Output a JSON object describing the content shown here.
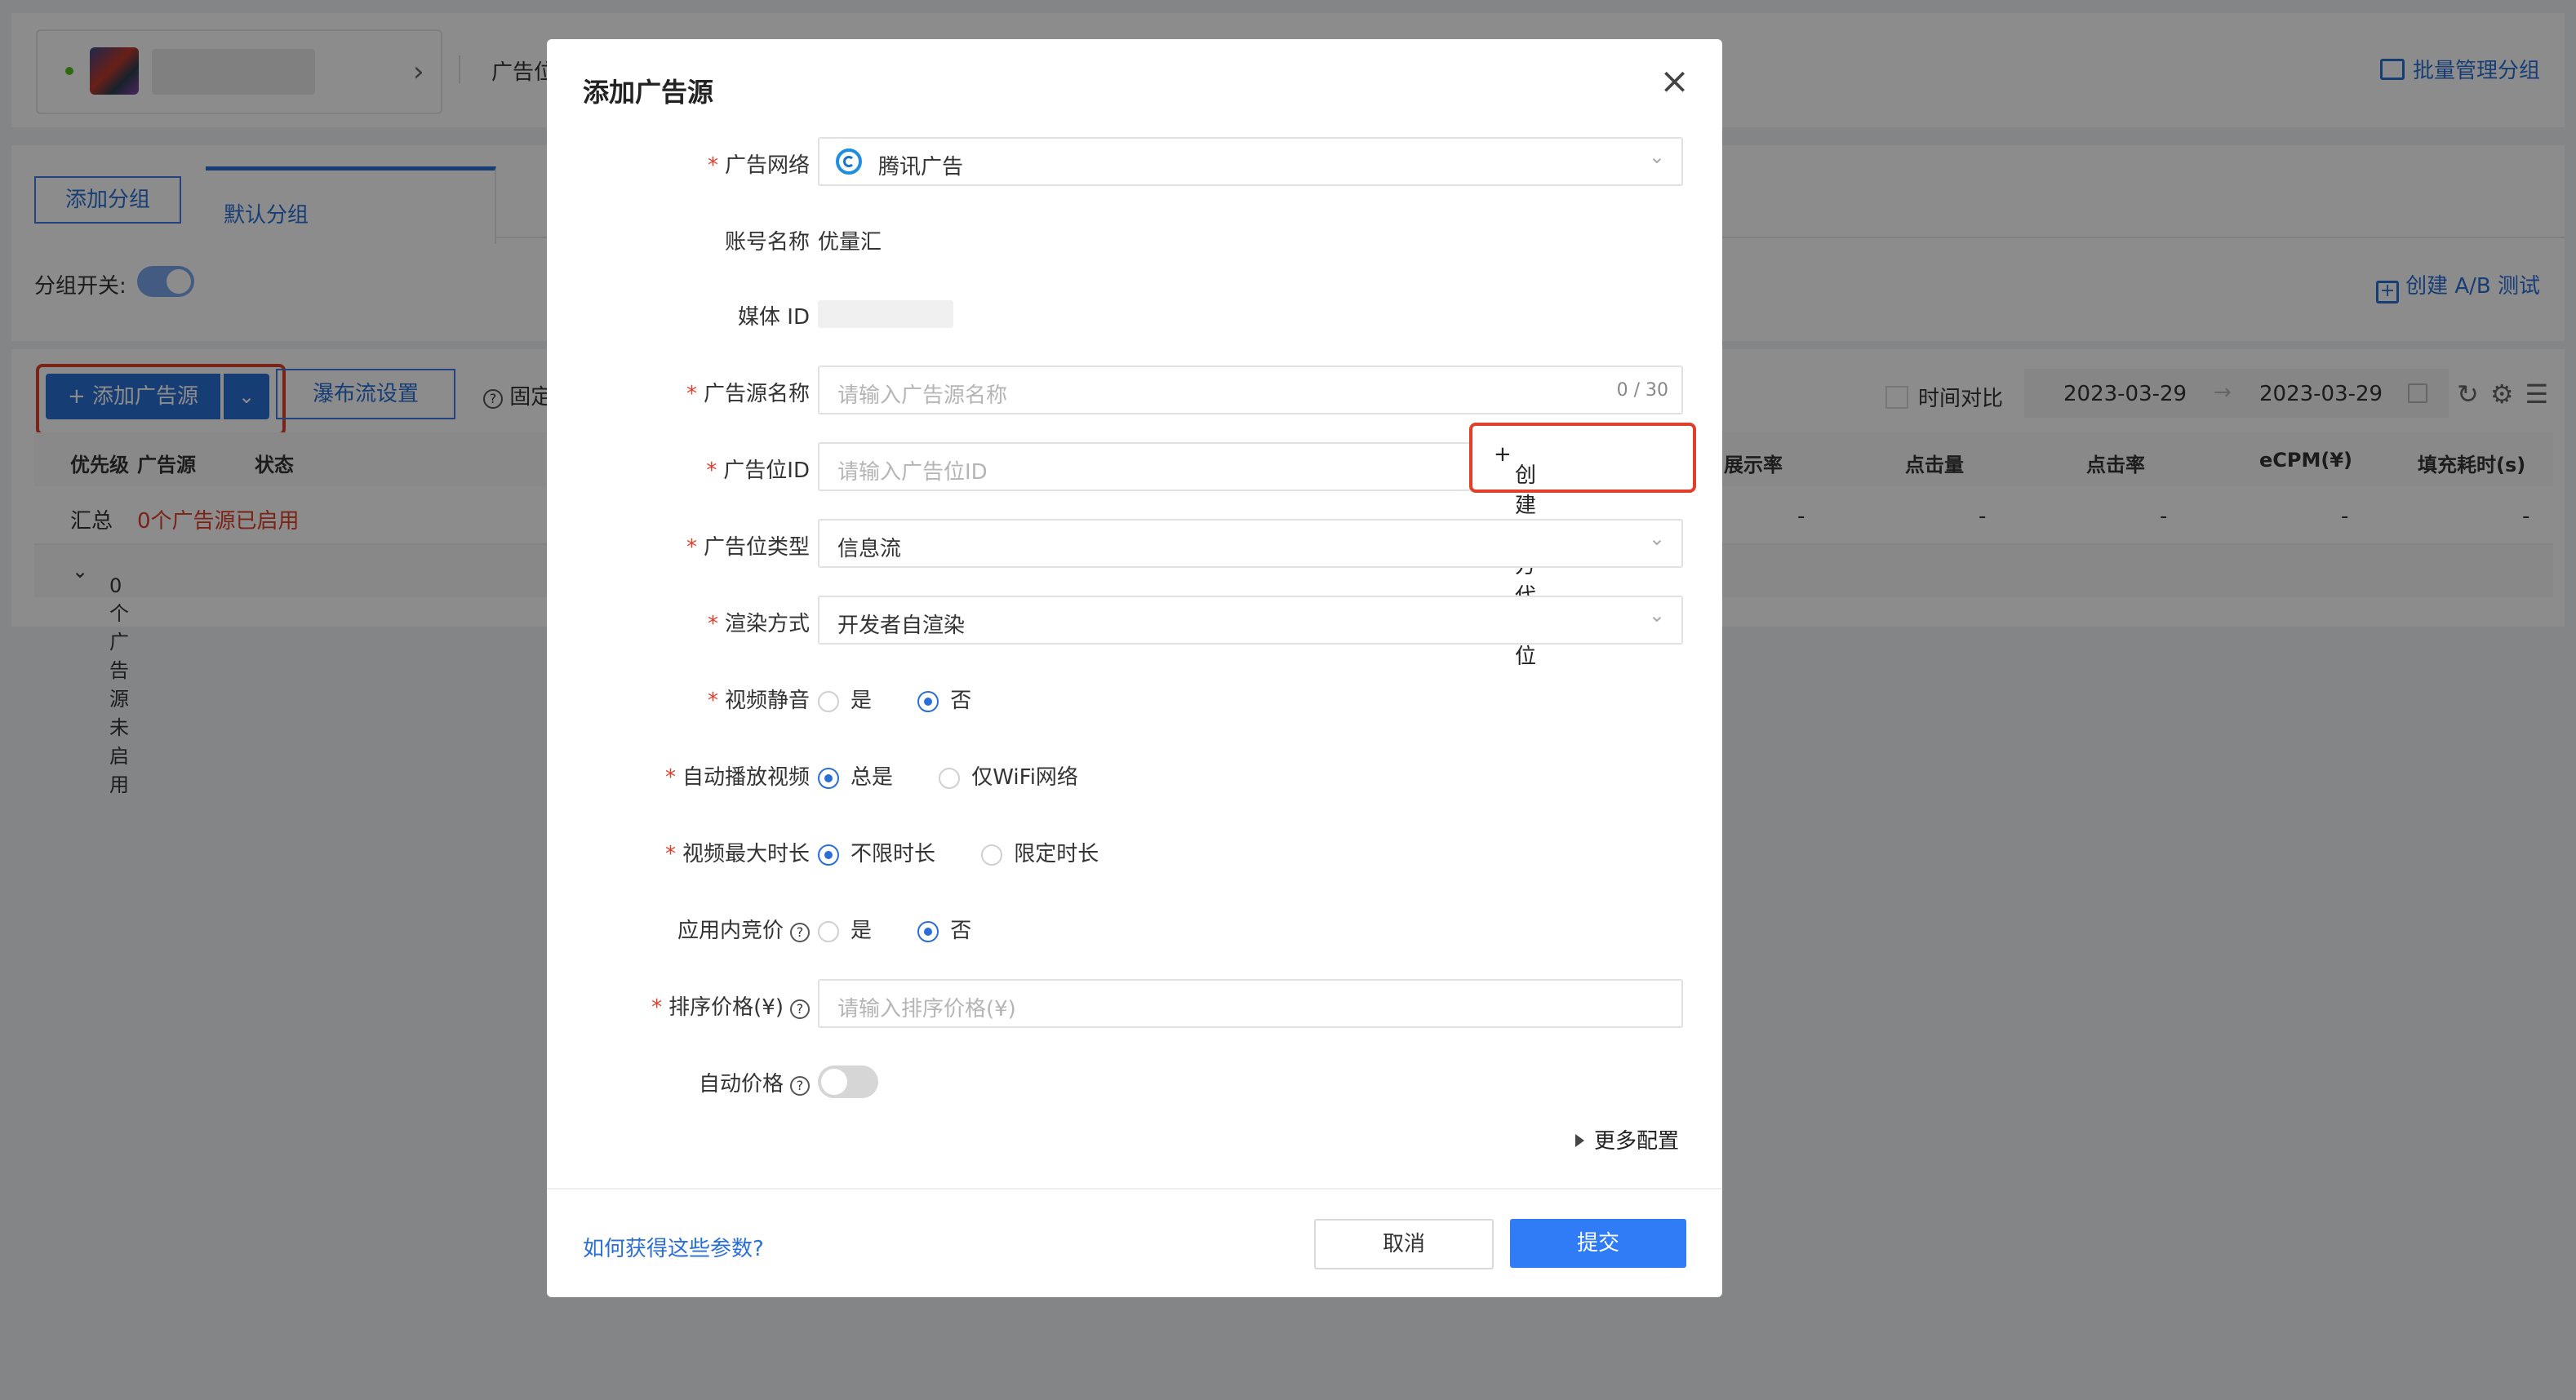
{
  "background": {
    "top_bar": {
      "breadcrumb": "广告位",
      "batch_manage": "批量管理分组"
    },
    "group_tabs": {
      "add_group": "添加分组",
      "default_group": "默认分组"
    },
    "group_switch_label": "分组开关:",
    "ab_test": "创建 A/B 测试",
    "toolbar": {
      "add_source": "添加广告源",
      "waterfall": "瀑布流设置",
      "fixed": "固定",
      "time_compare": "时间对比",
      "date_start": "2023-03-29",
      "date_end": "2023-03-29"
    },
    "table": {
      "columns": [
        "优先级",
        "广告源",
        "状态",
        "展示率",
        "点击量",
        "点击率",
        "eCPM(¥)",
        "填充耗时(s)"
      ],
      "summary_row": {
        "label": "汇总",
        "status": "0个广告源已启用",
        "values": [
          "-",
          "-",
          "-",
          "-",
          "-"
        ]
      },
      "inactive_row": "0个广告源未启用"
    }
  },
  "modal": {
    "title": "添加广告源",
    "fields": {
      "ad_network": {
        "label": "广告网络",
        "value": "腾讯广告"
      },
      "account_name": {
        "label": "账号名称",
        "value": "优量汇"
      },
      "media_id": {
        "label": "媒体 ID"
      },
      "source_name": {
        "label": "广告源名称",
        "placeholder": "请输入广告源名称",
        "count": "0 / 30"
      },
      "ad_slot_id": {
        "label": "广告位ID",
        "placeholder": "请输入广告位ID",
        "create_button": "创建三方代码位"
      },
      "ad_slot_type": {
        "label": "广告位类型",
        "value": "信息流"
      },
      "render_mode": {
        "label": "渲染方式",
        "value": "开发者自渲染"
      },
      "video_mute": {
        "label": "视频静音",
        "options": [
          "是",
          "否"
        ],
        "selected": "否"
      },
      "autoplay": {
        "label": "自动播放视频",
        "options": [
          "总是",
          "仅WiFi网络"
        ],
        "selected": "总是"
      },
      "video_max": {
        "label": "视频最大时长",
        "options": [
          "不限时长",
          "限定时长"
        ],
        "selected": "不限时长"
      },
      "in_app_bidding": {
        "label": "应用内竞价",
        "options": [
          "是",
          "否"
        ],
        "selected": "否"
      },
      "sort_price": {
        "label": "排序价格(¥)",
        "placeholder": "请输入排序价格(¥)"
      },
      "auto_price": {
        "label": "自动价格",
        "enabled": false
      }
    },
    "more_config": "更多配置",
    "help_link": "如何获得这些参数?",
    "cancel": "取消",
    "submit": "提交"
  },
  "colors": {
    "primary": "#2a6fd6",
    "submit": "#2f7cf6",
    "highlight_border": "#e0402b",
    "required": "#e0402b"
  }
}
